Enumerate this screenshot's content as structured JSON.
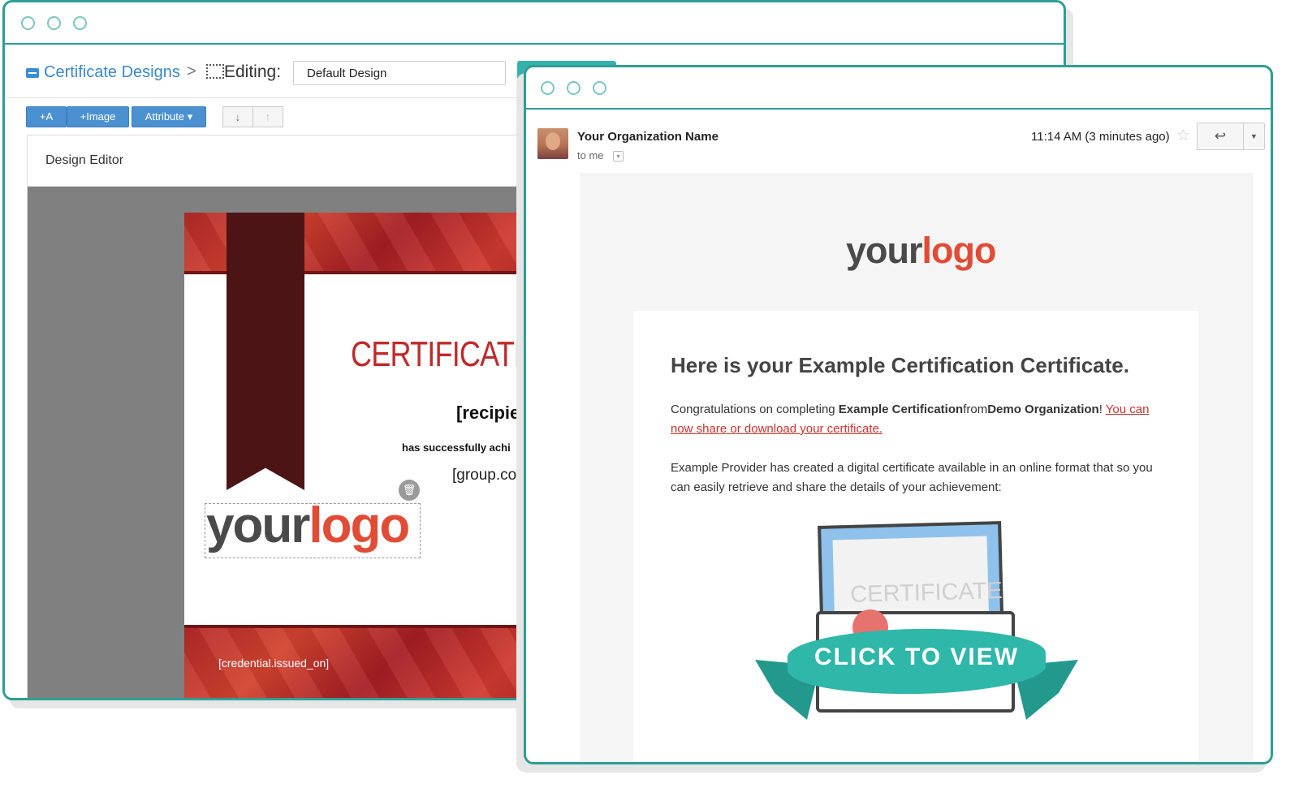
{
  "designer": {
    "breadcrumb_link": "Certificate Designs",
    "breadcrumb_sep": ">",
    "editing_label": "Editing:",
    "design_name": "Default Design",
    "toolbar": {
      "add_text": "+A",
      "add_image": "+Image",
      "attribute": "Attribute ▾",
      "move_down": "↓",
      "move_up": "↑"
    },
    "panel_title": "Design Editor",
    "certificate": {
      "title": "CERTIFICATE O",
      "recipient": "[recipier",
      "achieved": "has successfully achi",
      "group": "[group.cou",
      "logo_your": "your",
      "logo_logo": "logo",
      "issued_on": "[credential.issued_on]",
      "delete_icon": "🗑"
    }
  },
  "email": {
    "sender": "Your Organization Name",
    "to": "to me",
    "time": "11:14 AM (3 minutes ago)",
    "star": "☆",
    "reply_icon": "↩",
    "more_icon": "▼",
    "logo_your": "your",
    "logo_logo": "logo",
    "heading": "Here is your Example Certification Certificate.",
    "p1_pre": "Congratulations on completing ",
    "p1_cert": "Example Certification",
    "p1_from": "from",
    "p1_org": "Demo Organization",
    "p1_bang": "! ",
    "p1_link": "You can now share or download your certificate.",
    "p2": "Example Provider has created a digital certificate available in an online format that so you can easily retrieve and share the details of your achievement:",
    "illustration_word": "CERTIFICATE",
    "cta": "CLICK TO VIEW"
  },
  "colors": {
    "frame": "#2e9e96",
    "link_blue": "#3a87c8",
    "button_blue": "#4b90d0",
    "cert_red": "#c02a2a",
    "logo_grey": "#4a4a4a",
    "logo_orange": "#e14c36",
    "teal": "#2fb7a9"
  }
}
